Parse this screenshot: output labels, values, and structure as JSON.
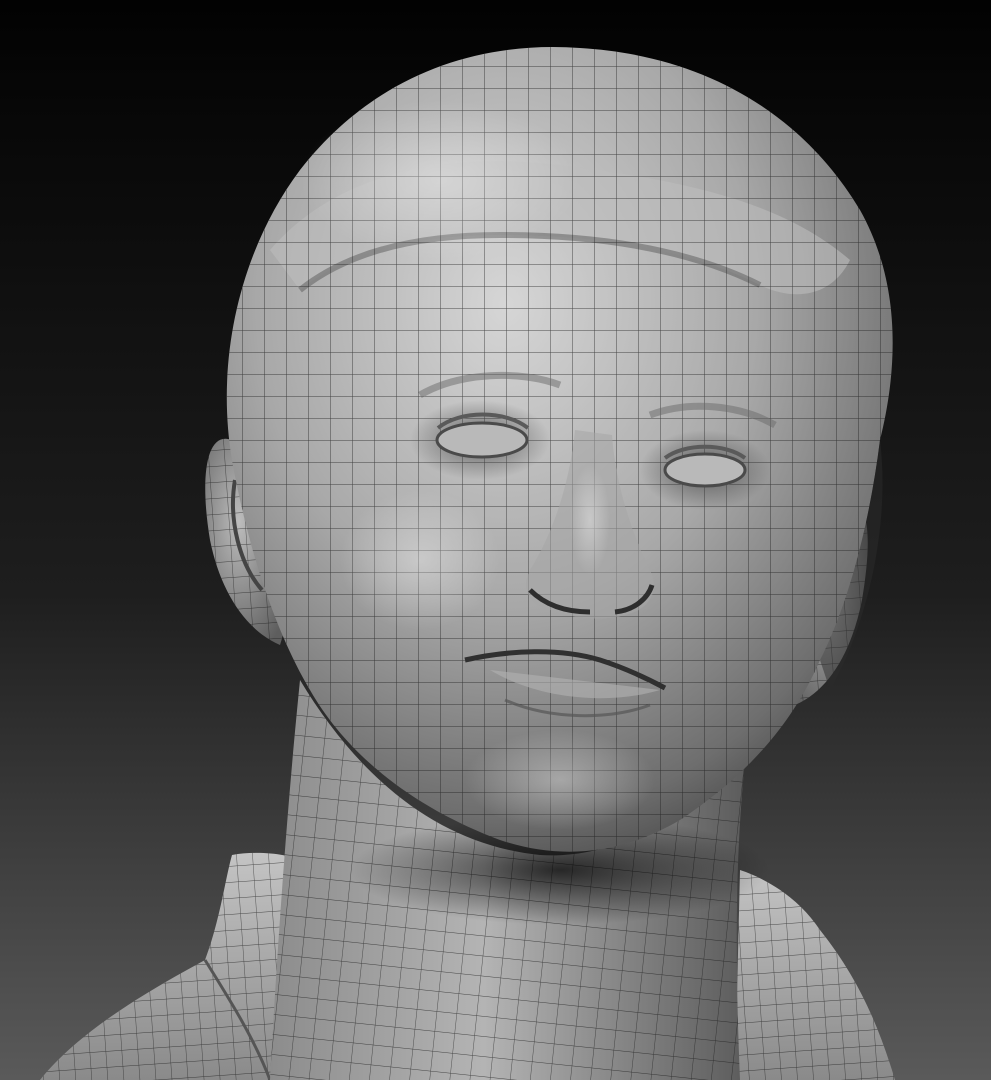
{
  "scene": {
    "subject": "sculpted-head-bust",
    "view": "three-quarter-front",
    "wireframe_overlay": true,
    "colors": {
      "background_top": "#020202",
      "background_bottom": "#5a5a5a",
      "clay_light": "#cfcfcf",
      "clay_mid": "#9c9c9c",
      "clay_dark": "#3a3a3a",
      "wire": "#1a1a1a"
    }
  }
}
